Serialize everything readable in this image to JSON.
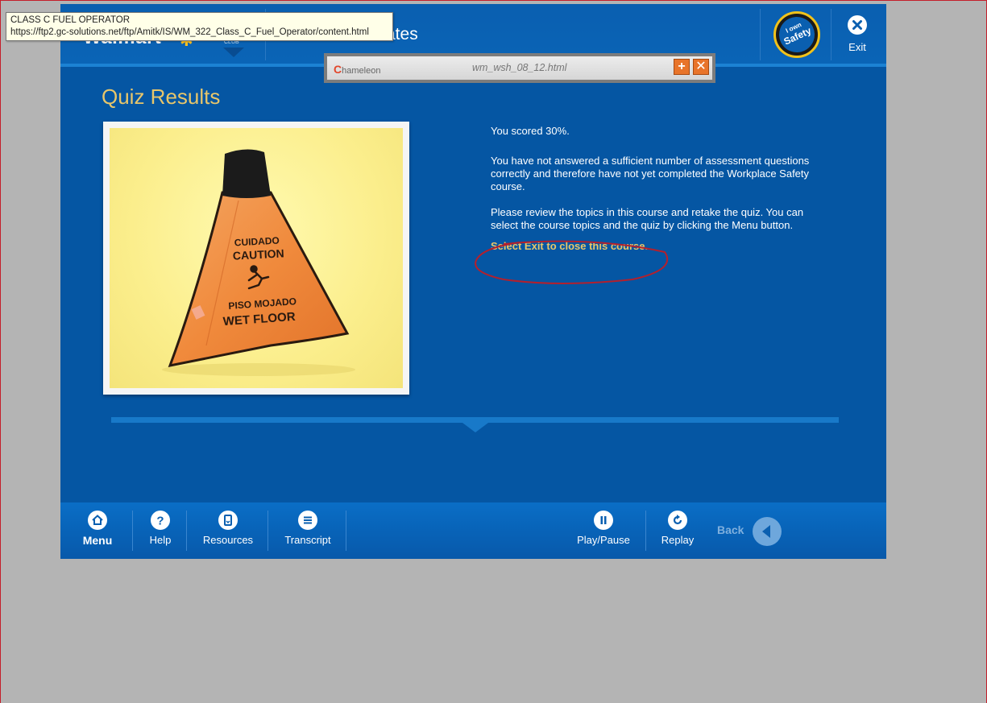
{
  "tooltip": {
    "title": "CLASS C FUEL OPERATOR",
    "url": "https://ftp2.gc-solutions.net/ftp/Amitk/IS/WM_322_Class_C_Fuel_Operator/content.html"
  },
  "header": {
    "logo": "Walmart",
    "logo_sub": "CLUB",
    "course_title_fragment": "ates",
    "safety_badge": {
      "line1": "I own",
      "line2": "Safety"
    },
    "exit_label": "Exit"
  },
  "chameleon": {
    "logo_c": "C",
    "logo_rest": "hameleon",
    "title": "wm_wsh_08_12.html",
    "add_icon": "plus-icon",
    "close_icon": "close-icon"
  },
  "page": {
    "title": "Quiz Results",
    "photo_alt": "Orange wet floor caution cone",
    "sign_text": {
      "line1": "CUIDADO",
      "line2": "CAUTION",
      "line3": "PISO MOJADO",
      "line4": "WET FLOOR"
    },
    "score": "You scored 30%.",
    "para1_line1": "You have not answered a sufficient number of assessment questions",
    "para1_line2": "correctly and therefore have not yet completed the Workplace Safety",
    "para1_line3": "course.",
    "para2_line1": "Please review the topics in this course and retake the quiz.  You can",
    "para2_line2": "select the course topics and the quiz by clicking the Menu button.",
    "exit_instruction": "Select Exit to close this course."
  },
  "bottom_nav": {
    "menu": "Menu",
    "help": "Help",
    "resources": "Resources",
    "transcript": "Transcript",
    "play_pause": "Play/Pause",
    "replay": "Replay",
    "back": "Back"
  },
  "colors": {
    "course_bg": "#0556a3",
    "accent_gold": "#e8c66a",
    "annotation_red": "#b3202d"
  }
}
